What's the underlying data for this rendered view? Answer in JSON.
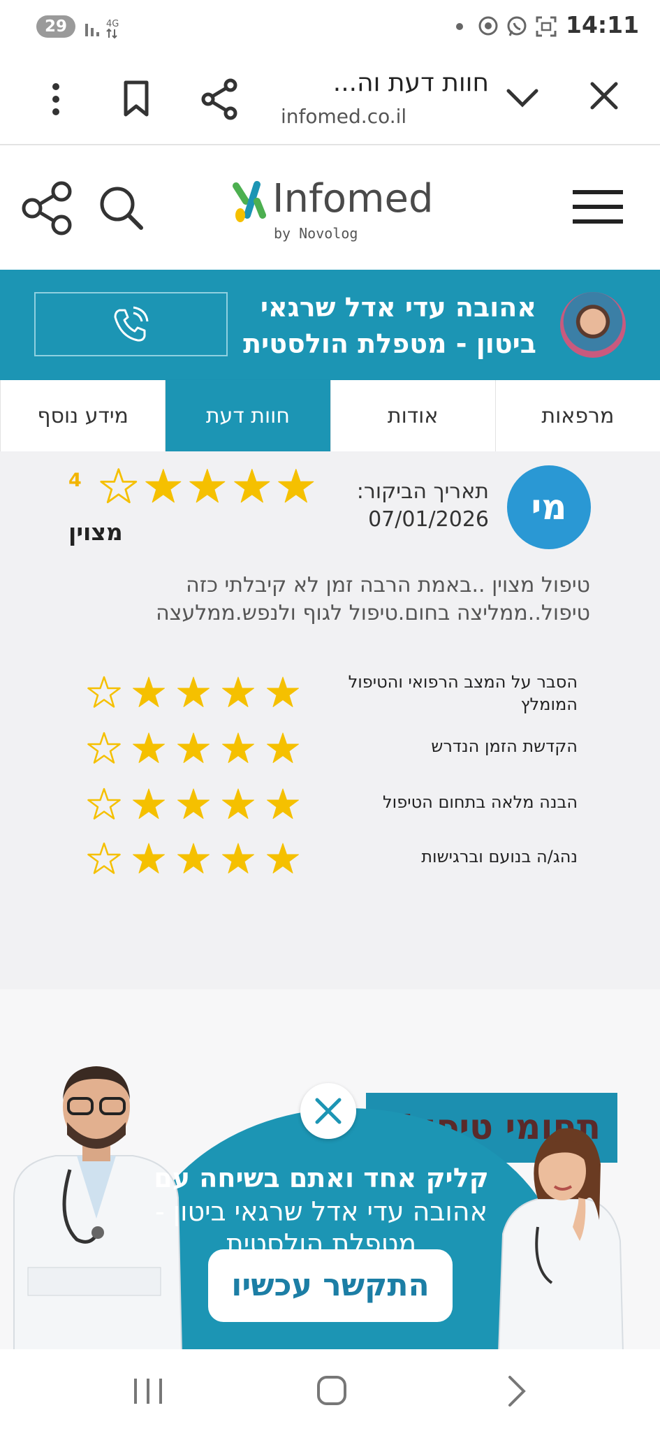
{
  "status_bar": {
    "battery": "29",
    "network": "4G",
    "time": "14:11"
  },
  "browser": {
    "title": "חוות דעת וה...",
    "domain": "infomed.co.il"
  },
  "site_header": {
    "logo": "Infomed",
    "logo_sub": "by Novolog"
  },
  "doctor": {
    "name_line1": "אהובה עדי אדל שרגאי",
    "name_line2": "ביטון - מטפלת הולסטית"
  },
  "tabs": [
    {
      "label": "מרפאות",
      "active": false
    },
    {
      "label": "אודות",
      "active": false
    },
    {
      "label": "חוות דעת",
      "active": true
    },
    {
      "label": "מידע נוסף",
      "active": false
    }
  ],
  "review": {
    "initials": "מי",
    "visit_label": "תאריך הביקור:",
    "visit_date": "07/01/2026",
    "rating_number": "4",
    "rating_stars": 4,
    "rating_out_of": 5,
    "rating_word": "מצוין",
    "text": "טיפול מצוין ..באמת הרבה זמן לא קיבלתי כזה טיפול..ממליצה בחום.טיפול לגוף ולנפש.ממלעצה",
    "criteria": [
      {
        "label": "הסבר על המצב הרפואי והטיפול המומלץ",
        "stars": 4
      },
      {
        "label": "הקדשת הזמן הנדרש",
        "stars": 4
      },
      {
        "label": "הבנה מלאה בתחום הטיפול",
        "stars": 4
      },
      {
        "label": "נהג/ה בנועם וברגישות",
        "stars": 4
      }
    ]
  },
  "ad": {
    "section_title": "תחומי טיפול",
    "line1": "קליק אחד ואתם בשיחה עם",
    "line2": "אהובה עדי אדל שרגאי ביטון -",
    "line3": "מטפלת הולסטית",
    "button": "התקשר עכשיו"
  },
  "colors": {
    "brand": "#1c95b4",
    "star": "#f5c000",
    "badge": "#2a98d4"
  }
}
